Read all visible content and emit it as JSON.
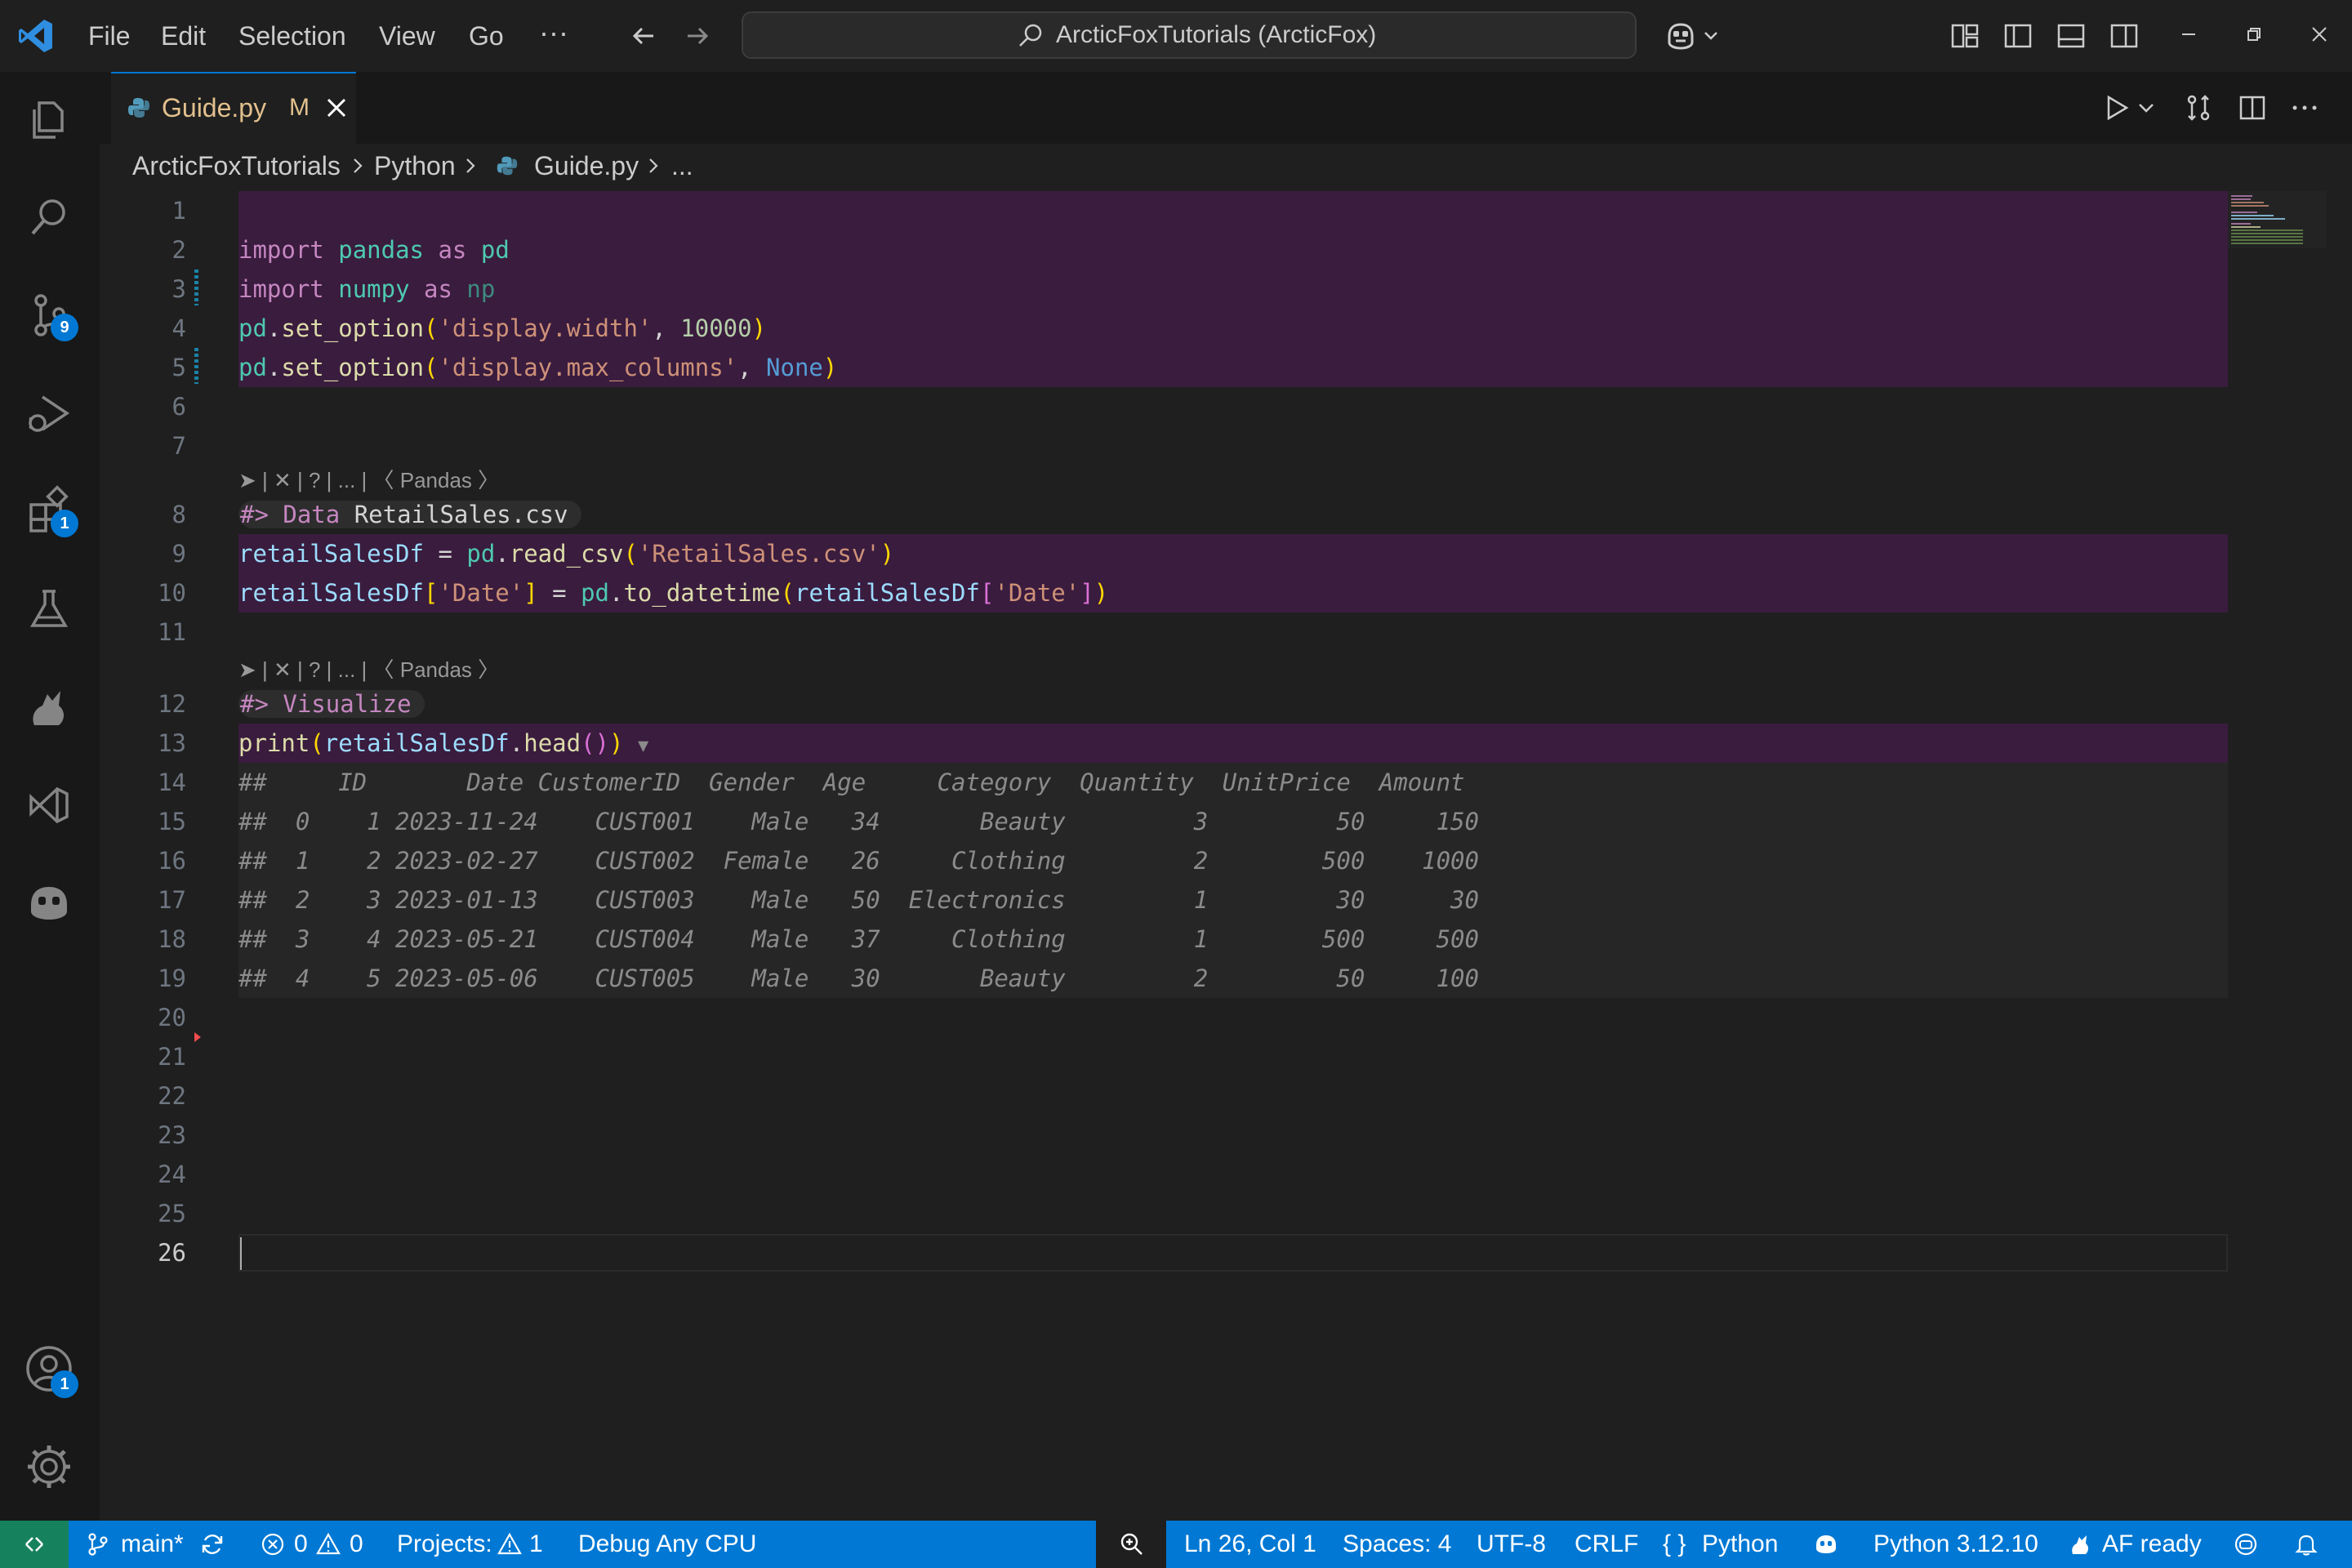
{
  "menu": {
    "file": "File",
    "edit": "Edit",
    "selection": "Selection",
    "view": "View",
    "go": "Go",
    "more": "···"
  },
  "command_center": {
    "text": "ArcticFoxTutorials (ArcticFox)"
  },
  "activity": {
    "scm_badge": "9",
    "extensions_badge": "1",
    "accounts_badge": "1"
  },
  "tab": {
    "label": "Guide.py",
    "modified": "M"
  },
  "breadcrumb": {
    "root": "ArcticFoxTutorials",
    "folder": "Python",
    "file": "Guide.py",
    "more": "..."
  },
  "editor": {
    "line_numbers": [
      "1",
      "2",
      "3",
      "4",
      "5",
      "6",
      "7",
      "8",
      "9",
      "10",
      "11",
      "12",
      "13",
      "14",
      "15",
      "16",
      "17",
      "18",
      "19",
      "20",
      "21",
      "22",
      "23",
      "24",
      "25",
      "26"
    ],
    "lens": "➤ | ✕ | ? | ... | 〈 Pandas 〉",
    "chunk1_prefix": "#>",
    "chunk1_kw": "Data",
    "chunk1_name": "RetailSales.csv",
    "chunk2_prefix": "#>",
    "chunk2_name": "Visualize",
    "output_lines": [
      "##     ID       Date CustomerID  Gender  Age     Category  Quantity  UnitPrice  Amount",
      "##  0    1 2023-11-24    CUST001    Male   34       Beauty         3         50     150",
      "##  1    2 2023-02-27    CUST002  Female   26     Clothing         2        500    1000",
      "##  2    3 2023-01-13    CUST003    Male   50  Electronics         1         30      30",
      "##  3    4 2023-05-21    CUST004    Male   37     Clothing         1        500     500",
      "##  4    5 2023-05-06    CUST005    Male   30       Beauty         2         50     100"
    ]
  },
  "colors": {
    "accent": "#0078d4",
    "highlight": "#3a1c3e",
    "remote": "#16825d"
  },
  "status": {
    "branch": "main*",
    "errors": "0",
    "warnings": "0",
    "projects": "Projects:",
    "projects_count": "1",
    "debug": "Debug Any CPU",
    "position": "Ln 26, Col 1",
    "spaces": "Spaces: 4",
    "encoding": "UTF-8",
    "eol": "CRLF",
    "language": "Python",
    "interpreter": "Python 3.12.10",
    "af": "AF ready"
  }
}
